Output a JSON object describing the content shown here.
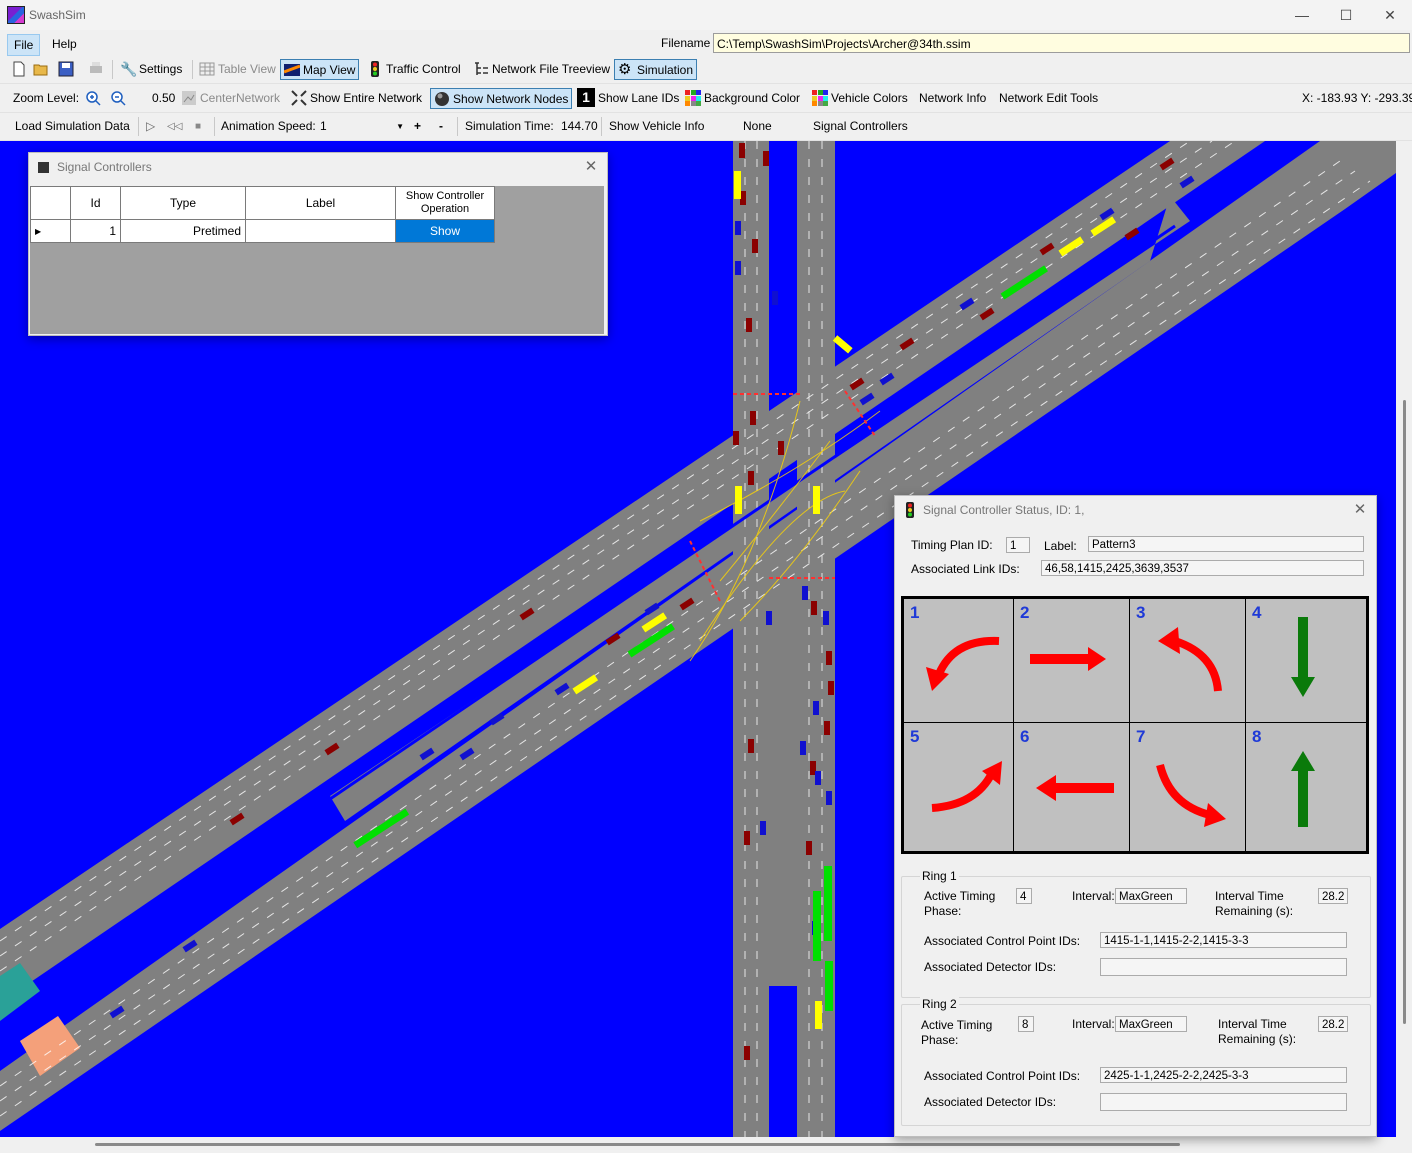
{
  "window": {
    "title": "SwashSim",
    "minimize_glyph": "—",
    "maximize_glyph": "☐",
    "close_glyph": "✕"
  },
  "menu": {
    "file": "File",
    "help": "Help"
  },
  "filename": {
    "label": "Filename",
    "value": "C:\\Temp\\SwashSim\\Projects\\Archer@34th.ssim"
  },
  "toolbar1": {
    "settings": "Settings",
    "table_view": "Table View",
    "map_view": "Map View",
    "traffic_control": "Traffic Control",
    "network_file_treeview": "Network File Treeview",
    "simulation": "Simulation"
  },
  "toolbar2": {
    "zoom_label": "Zoom Level:",
    "zoom_value": "0.50",
    "center_network": "CenterNetwork",
    "show_entire_network": "Show Entire Network",
    "show_network_nodes": "Show Network Nodes",
    "show_lane_ids": "Show Lane IDs",
    "lane_id_glyph": "1",
    "background_color": "Background Color",
    "vehicle_colors": "Vehicle Colors",
    "network_info": "Network Info",
    "network_edit_tools": "Network Edit Tools",
    "coords": "X: -183.93 Y: -293.39"
  },
  "toolbar3": {
    "load_simulation_data": "Load Simulation Data",
    "play_glyph": "▷",
    "rewind_glyph": "◁◁",
    "stop_glyph": "■",
    "animation_speed_label": "Animation Speed:",
    "animation_speed_value": "1",
    "plus": "+",
    "minus": "-",
    "simulation_time_label": "Simulation Time:",
    "simulation_time_value": "144.70",
    "show_vehicle_info": "Show Vehicle Info",
    "vehicle_info_value": "None",
    "signal_controllers": "Signal Controllers"
  },
  "signal_controllers_panel": {
    "title": "Signal Controllers",
    "columns": [
      "Id",
      "Type",
      "Label",
      "Show Controller Operation"
    ],
    "rows": [
      {
        "id": "1",
        "type": "Pretimed",
        "label": "",
        "action": "Show"
      }
    ]
  },
  "status_panel": {
    "title": "Signal Controller Status, ID: 1,",
    "timing_plan_label": "Timing Plan ID:",
    "timing_plan_value": "1",
    "label_label": "Label:",
    "label_value": "Pattern3",
    "assoc_links_label": "Associated Link IDs:",
    "assoc_links_value": "46,58,1415,2425,3639,3537",
    "phases": [
      {
        "num": "1",
        "icon": "left-turn-arrow-icon",
        "color": "#ff0000"
      },
      {
        "num": "2",
        "icon": "right-arrow-icon",
        "color": "#ff0000"
      },
      {
        "num": "3",
        "icon": "left-turn-arrow-icon",
        "color": "#ff0000"
      },
      {
        "num": "4",
        "icon": "down-arrow-icon",
        "color": "#0a7a0a"
      },
      {
        "num": "5",
        "icon": "left-turn-arrow-icon",
        "color": "#ff0000"
      },
      {
        "num": "6",
        "icon": "left-arrow-icon",
        "color": "#ff0000"
      },
      {
        "num": "7",
        "icon": "right-turn-arrow-icon",
        "color": "#ff0000"
      },
      {
        "num": "8",
        "icon": "up-arrow-icon",
        "color": "#0a7a0a"
      }
    ],
    "ring1": {
      "title": "Ring 1",
      "active_phase_label": "Active Timing Phase:",
      "active_phase_value": "4",
      "interval_label": "Interval:",
      "interval_value": "MaxGreen",
      "remaining_label": "Interval Time Remaining (s):",
      "remaining_value": "28.2",
      "control_points_label": "Associated Control Point IDs:",
      "control_points_value": "1415-1-1,1415-2-2,1415-3-3",
      "detectors_label": "Associated Detector IDs:",
      "detectors_value": ""
    },
    "ring2": {
      "title": "Ring 2",
      "active_phase_label": "Active Timing Phase:",
      "active_phase_value": "8",
      "interval_label": "Interval:",
      "interval_value": "MaxGreen",
      "remaining_label": "Interval Time Remaining (s):",
      "remaining_value": "28.2",
      "control_points_label": "Associated Control Point IDs:",
      "control_points_value": "2425-1-1,2425-2-2,2425-3-3",
      "detectors_label": "Associated Detector IDs:",
      "detectors_value": ""
    }
  },
  "colors": {
    "map_background": "#0000ff",
    "road": "#808080",
    "vehicle_red": "#8b0000",
    "vehicle_blue": "#1010d0",
    "vehicle_yellow": "#ffff00",
    "detector_green": "#00e000",
    "phase_red": "#ff0000",
    "phase_green": "#0a7a0a"
  }
}
